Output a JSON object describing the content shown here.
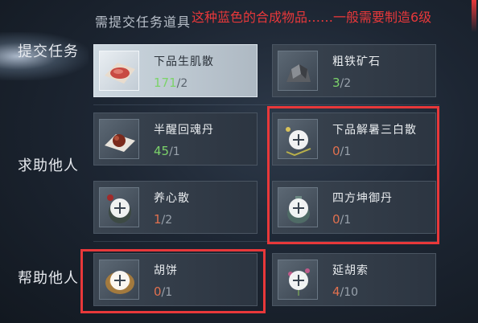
{
  "side_nav": {
    "submit_task": "提交任务",
    "seek_help": "求助他人",
    "help_others": "帮助他人"
  },
  "section_title": "需提交任务道具",
  "annotation": "这种蓝色的合成物品……一般需要制造6级",
  "items": [
    {
      "name": "下品生肌散",
      "current": "171",
      "required": "/2",
      "current_color": "#7cd36a",
      "icon": "powder-packet-icon",
      "has_plus": false
    },
    {
      "name": "粗铁矿石",
      "current": "3",
      "required": "/2",
      "current_color": "#7cd36a",
      "icon": "iron-ore-icon",
      "has_plus": false
    },
    {
      "name": "半醒回魂丹",
      "current": "45",
      "required": "/1",
      "current_color": "#7cd36a",
      "icon": "pill-on-paper-icon",
      "has_plus": false
    },
    {
      "name": "下品解暑三白散",
      "current": "0",
      "required": "/1",
      "current_color": "#e0704f",
      "icon": "herb-powder-icon",
      "has_plus": true
    },
    {
      "name": "养心散",
      "current": "1",
      "required": "/2",
      "current_color": "#e0704f",
      "icon": "medicine-bottle-icon",
      "has_plus": true
    },
    {
      "name": "四方坤御丹",
      "current": "0",
      "required": "/1",
      "current_color": "#e0704f",
      "icon": "jade-bottle-icon",
      "has_plus": true
    },
    {
      "name": "胡饼",
      "current": "0",
      "required": "/1",
      "current_color": "#e0704f",
      "icon": "flatbread-icon",
      "has_plus": true
    },
    {
      "name": "延胡索",
      "current": "4",
      "required": "/10",
      "current_color": "#e0704f",
      "icon": "herb-plant-icon",
      "has_plus": true
    }
  ],
  "colors": {
    "highlight_box": "#e8383a",
    "enough": "#7cd36a",
    "insufficient": "#e0704f"
  }
}
